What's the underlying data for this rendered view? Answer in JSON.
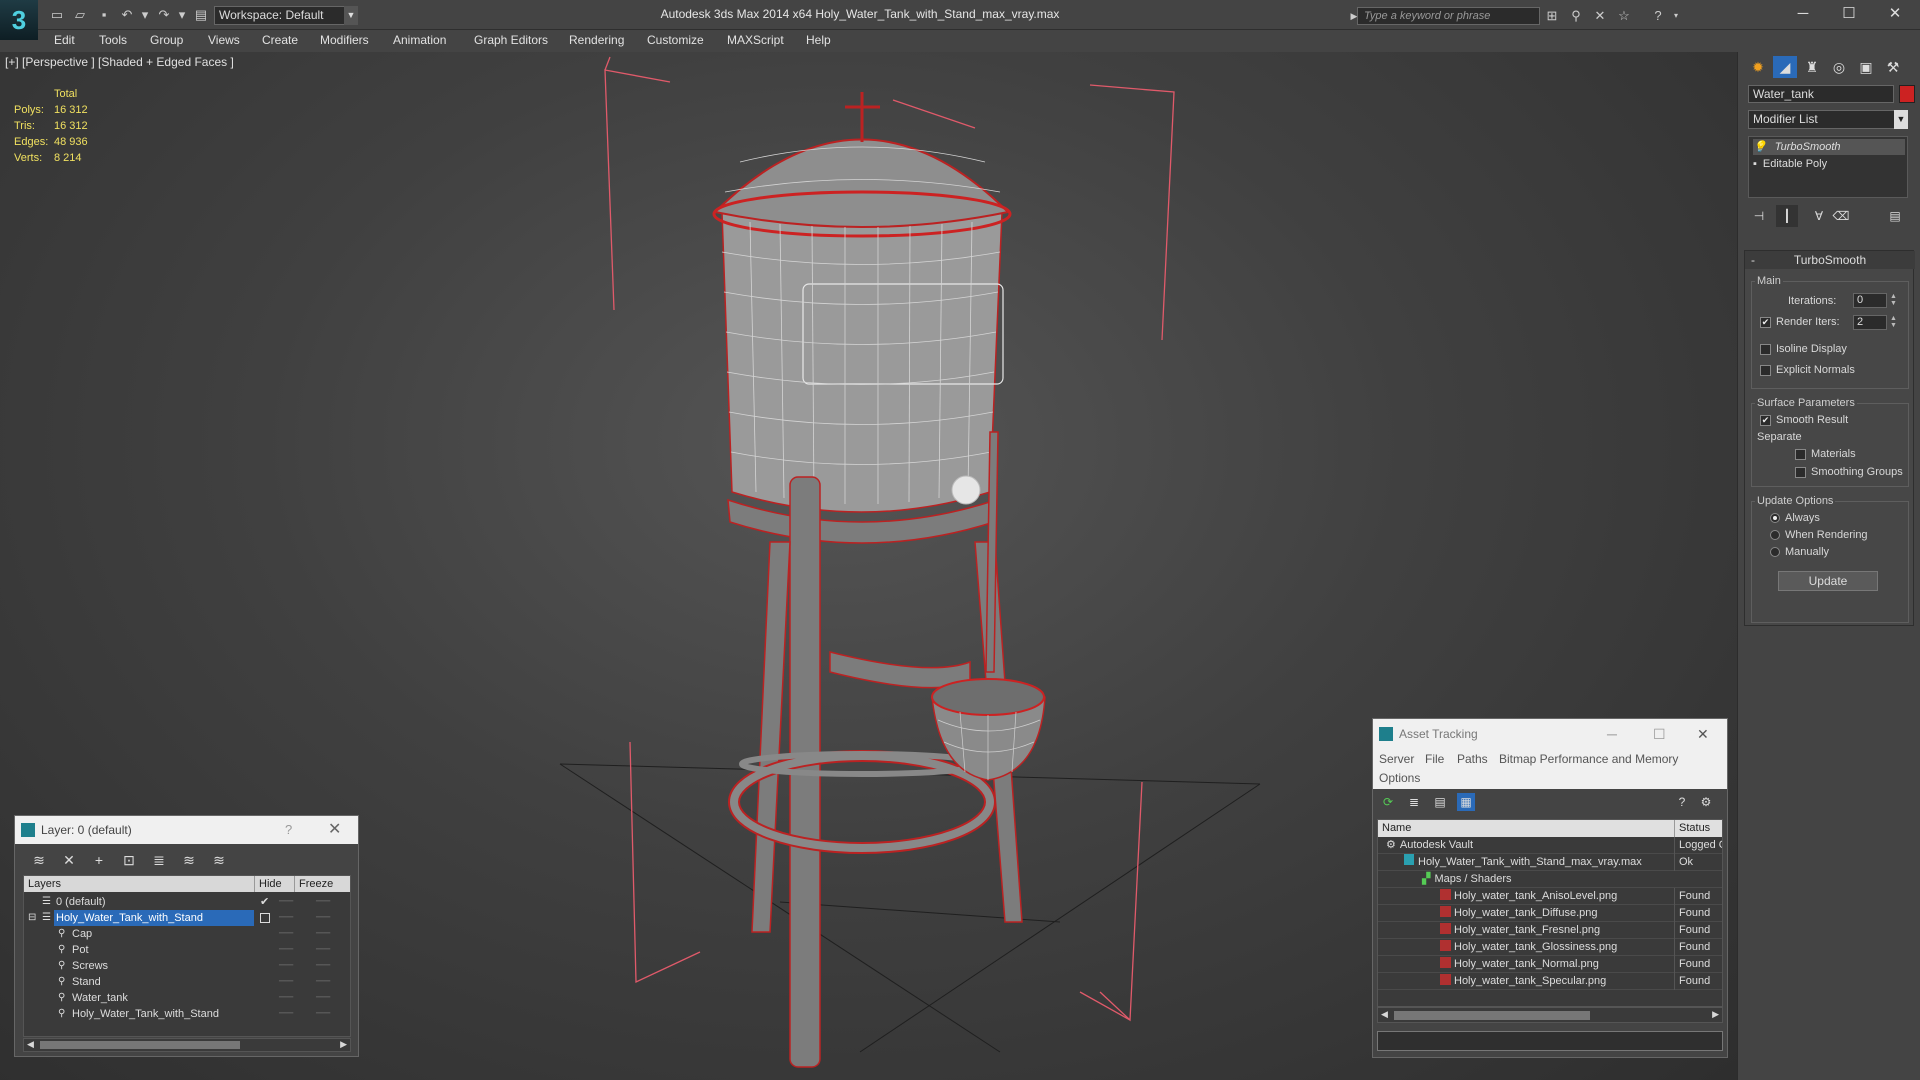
{
  "app": {
    "title": "Autodesk 3ds Max  2014 x64     Holy_Water_Tank_with_Stand_max_vray.max",
    "logo": "3",
    "workspace": "Workspace: Default",
    "search_placeholder": "Type a keyword or phrase"
  },
  "menu": [
    "Edit",
    "Tools",
    "Group",
    "Views",
    "Create",
    "Modifiers",
    "Animation",
    "Graph Editors",
    "Rendering",
    "Customize",
    "MAXScript",
    "Help"
  ],
  "viewport": {
    "label": "[+] [Perspective ] [Shaded + Edged Faces ]",
    "stats": {
      "header": "Total",
      "rows": [
        {
          "label": "Polys:",
          "value": "16 312"
        },
        {
          "label": "Tris:",
          "value": "16 312"
        },
        {
          "label": "Edges:",
          "value": "48 936"
        },
        {
          "label": "Verts:",
          "value": "8 214"
        }
      ]
    }
  },
  "command_panel": {
    "object_name": "Water_tank",
    "object_color": "#cc2222",
    "modifier_list": "Modifier List",
    "stack": [
      "TurboSmooth",
      "Editable Poly"
    ],
    "turbosmooth": {
      "title": "TurboSmooth",
      "main_group": "Main",
      "iterations_label": "Iterations:",
      "iterations_value": "0",
      "render_iters_label": "Render Iters:",
      "render_iters_value": "2",
      "render_iters_checked": true,
      "isoline_label": "Isoline Display",
      "explicit_normals_label": "Explicit Normals",
      "surface_group": "Surface Parameters",
      "smooth_result_label": "Smooth Result",
      "separate_label": "Separate",
      "materials_label": "Materials",
      "smoothing_groups_label": "Smoothing Groups",
      "update_group": "Update Options",
      "always_label": "Always",
      "when_rendering_label": "When Rendering",
      "manually_label": "Manually",
      "update_button": "Update"
    }
  },
  "layer_window": {
    "title": "Layer: 0 (default)",
    "help": "?",
    "columns": {
      "layers": "Layers",
      "hide": "Hide",
      "freeze": "Freeze"
    },
    "rows": [
      {
        "name": "0 (default)",
        "indent": 1,
        "selected": false
      },
      {
        "name": "Holy_Water_Tank_with_Stand",
        "indent": 1,
        "selected": true
      },
      {
        "name": "Cap",
        "indent": 2,
        "selected": false
      },
      {
        "name": "Pot",
        "indent": 2,
        "selected": false
      },
      {
        "name": "Screws",
        "indent": 2,
        "selected": false
      },
      {
        "name": "Stand",
        "indent": 2,
        "selected": false
      },
      {
        "name": "Water_tank",
        "indent": 2,
        "selected": false
      },
      {
        "name": "Holy_Water_Tank_with_Stand",
        "indent": 2,
        "selected": false
      }
    ]
  },
  "asset_window": {
    "title": "Asset Tracking",
    "menu": [
      "Server",
      "File",
      "Paths",
      "Bitmap Performance and Memory",
      "Options"
    ],
    "columns": {
      "name": "Name",
      "status": "Status"
    },
    "rows": [
      {
        "name": "Autodesk Vault",
        "status": "Logged O",
        "indent": 0,
        "icon": "vault-icon"
      },
      {
        "name": "Holy_Water_Tank_with_Stand_max_vray.max",
        "status": "Ok",
        "indent": 1,
        "icon": "max-file-icon"
      },
      {
        "name": "Maps / Shaders",
        "status": "",
        "indent": 2,
        "icon": "maps-icon"
      },
      {
        "name": "Holy_water_tank_AnisoLevel.png",
        "status": "Found",
        "indent": 3,
        "icon": "png-icon"
      },
      {
        "name": "Holy_water_tank_Diffuse.png",
        "status": "Found",
        "indent": 3,
        "icon": "png-icon"
      },
      {
        "name": "Holy_water_tank_Fresnel.png",
        "status": "Found",
        "indent": 3,
        "icon": "png-icon"
      },
      {
        "name": "Holy_water_tank_Glossiness.png",
        "status": "Found",
        "indent": 3,
        "icon": "png-icon"
      },
      {
        "name": "Holy_water_tank_Normal.png",
        "status": "Found",
        "indent": 3,
        "icon": "png-icon"
      },
      {
        "name": "Holy_water_tank_Specular.png",
        "status": "Found",
        "indent": 3,
        "icon": "png-icon"
      }
    ]
  }
}
